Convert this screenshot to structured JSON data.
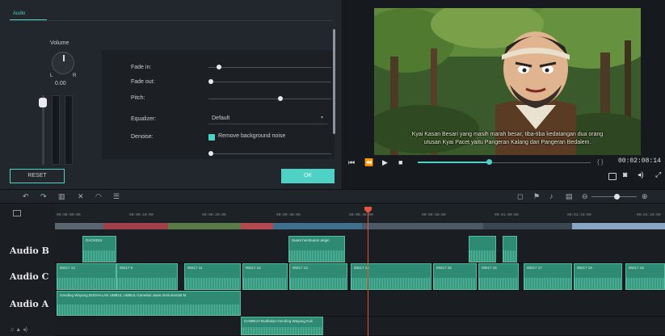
{
  "audio_panel": {
    "tab_label": "Audio",
    "volume_label": "Volume",
    "knob_left": "L",
    "knob_right": "R",
    "volume_value": "0.00",
    "fade_in_label": "Fade in:",
    "fade_out_label": "Fade out:",
    "pitch_label": "Pitch:",
    "equalizer_label": "Equalizer:",
    "equalizer_value": "Default",
    "denoise_label": "Denoise:",
    "denoise_option": "Remove background noise",
    "reset_button": "RESET",
    "ok_button": "OK"
  },
  "preview": {
    "subtitle_line1": "Kyai Kasan Besari yang masih marah besar, tiba-tiba kedatangan dua orang",
    "subtitle_line2": "utusan Kyai Pacet yaitu Pangeran Kalang dan Pangeran Bedalem.",
    "timecode": "00:02:08:14",
    "bracket_marks": "{ }"
  },
  "timeline": {
    "ruler_ticks": [
      "00:00:00:00",
      "00:00:10:00",
      "00:00:20:00",
      "00:00:30:00",
      "00:00:40:00",
      "00:00:50:00",
      "00:01:00:00",
      "00:01:10:00",
      "00:01:20:00"
    ],
    "tracks": [
      "Audio B",
      "Audio C",
      "Audio A"
    ],
    "audio_b_clips": [
      "DAOSDUI",
      "Suara hembusan angin"
    ],
    "audio_c_clips": [
      "00217 13",
      "00217 0",
      "00217 11",
      "00217 12",
      "00217 13",
      "00217 14",
      "00217 15",
      "00217 16",
      "00217 17",
      "00217 18",
      "00217 19"
    ],
    "audio_a_clip": "Gending Wayang BUDHALAN UMBUL UMBUL Gamelan Jawa Instrumental M",
    "bottom_clip": "GAMBUH Budhalan Gending Wayang Kuli"
  },
  "colors": {
    "accent": "#4fd1c5",
    "clip": "#2f8a73",
    "playhead": "#e2553f"
  }
}
